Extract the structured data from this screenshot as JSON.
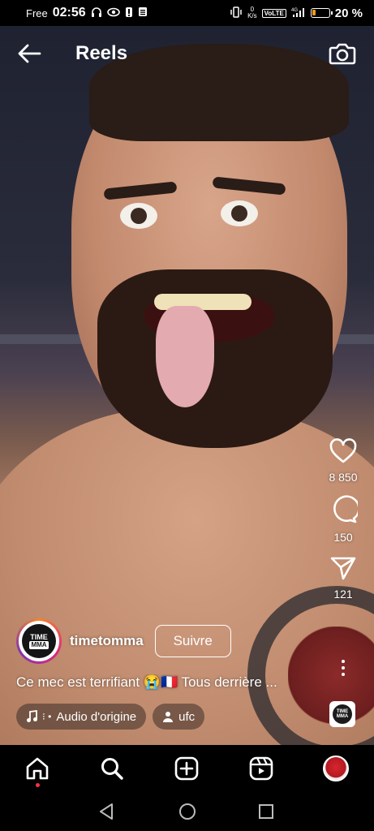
{
  "status_bar": {
    "carrier": "Free",
    "time": "02:56",
    "net_speed_value": "0",
    "net_speed_unit": "K/s",
    "volte": "VoLTE",
    "signal": "4G",
    "battery_percent": "20 %",
    "battery_level": 0.2
  },
  "header": {
    "title": "Reels",
    "back_icon": "arrow-left-icon",
    "camera_icon": "camera-icon"
  },
  "actions": {
    "likes": "8 850",
    "comments": "150",
    "shares": "121"
  },
  "author": {
    "username": "timetomma",
    "avatar_text_top": "TIME",
    "avatar_text_bottom": "MMA",
    "follow_label": "Suivre"
  },
  "caption": "Ce mec est terrifiant 😭🇫🇷 Tous derrière ...",
  "chips": {
    "audio": "Audio d'origine",
    "audio_prefix": "⁝ •",
    "tag": "ufc"
  },
  "audio_thumb": {
    "text": "TIME MMA"
  },
  "colors": {
    "accent_red": "#ff3040",
    "battery": "#f29a1e"
  }
}
